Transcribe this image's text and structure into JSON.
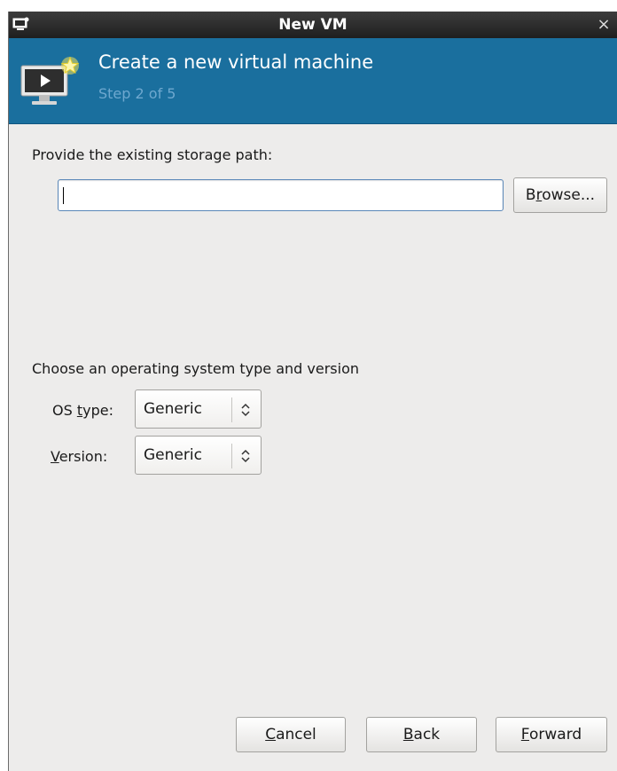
{
  "window": {
    "title": "New VM",
    "close_glyph": "×"
  },
  "header": {
    "heading": "Create a new virtual machine",
    "step": "Step 2 of 5",
    "background_color": "#1a6f9e",
    "step_color": "#6ea8cf"
  },
  "storage": {
    "label": "Provide the existing storage path:",
    "path_value": "",
    "browse_label_pre": "B",
    "browse_label_mnemonic": "r",
    "browse_label_post": "owse..."
  },
  "os": {
    "section_label": "Choose an operating system type and version",
    "type_label_pre": "OS ",
    "type_label_mnemonic": "t",
    "type_label_post": "ype:",
    "type_value": "Generic",
    "version_label_mnemonic": "V",
    "version_label_post": "ersion:",
    "version_value": "Generic"
  },
  "footer": {
    "cancel_mnemonic": "C",
    "cancel_post": "ancel",
    "back_mnemonic": "B",
    "back_post": "ack",
    "forward_mnemonic": "F",
    "forward_post": "orward"
  },
  "icons": {
    "window_icon": "computer-icon",
    "banner_icon": "vm-monitor-new-icon",
    "combo_arrows": "updown-arrows-icon",
    "close": "close-icon"
  }
}
